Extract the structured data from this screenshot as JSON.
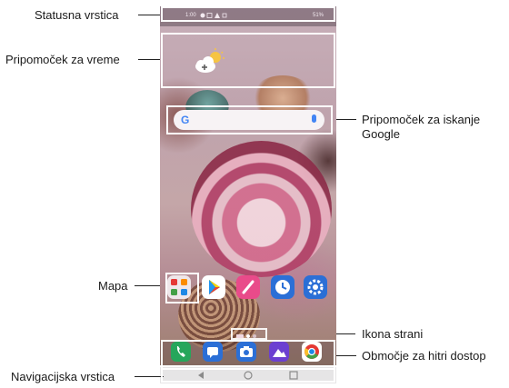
{
  "labels": {
    "status_bar": "Statusna vrstica",
    "weather_widget": "Pripomoček za vreme",
    "google_search_widget_line1": "Pripomoček za iskanje",
    "google_search_widget_line2": "Google",
    "folder": "Mapa",
    "page_icon": "Ikona strani",
    "quick_access": "Območje za hitri dostop",
    "nav_bar": "Navigacijska vrstica"
  },
  "phone": {
    "status": {
      "time": "1:00",
      "right": "51%"
    },
    "search": {
      "g": "G"
    }
  },
  "colors": {
    "phone_app": "#26a65b",
    "messages": "#2b6fd6",
    "camera": "#2b6fd6",
    "gallery": "#6b3fd1",
    "chrome": "#e53935",
    "play": "#ffffff",
    "memo": "#e94b8a",
    "clock": "#2b6fd6",
    "settings": "#2b6fd6"
  },
  "icons": [
    "cloud-sun-icon",
    "google-g-icon",
    "mic-icon",
    "folder-icon",
    "play-store-icon",
    "memo-icon",
    "clock-icon",
    "settings-icon",
    "phone-icon",
    "messages-icon",
    "camera-icon",
    "gallery-icon",
    "chrome-icon"
  ]
}
